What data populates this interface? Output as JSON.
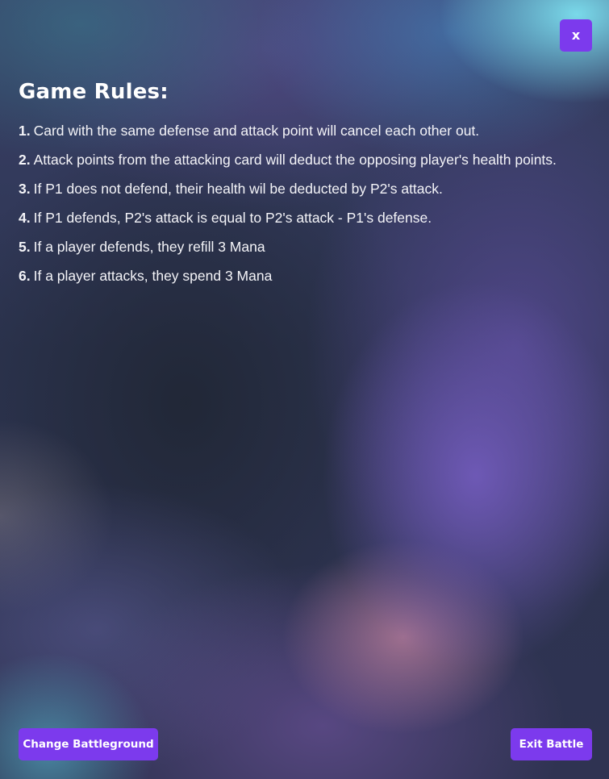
{
  "colors": {
    "accent": "#7c3aed",
    "text": "#ffffff"
  },
  "close_button": {
    "label": "x"
  },
  "rules": {
    "title": "Game Rules:",
    "items": [
      {
        "number": "1.",
        "text": "Card with the same defense and attack point will cancel each other out."
      },
      {
        "number": "2.",
        "text": "Attack points from the attacking card will deduct the opposing player's health points."
      },
      {
        "number": "3.",
        "text": "If P1 does not defend, their health wil be deducted by P2's attack."
      },
      {
        "number": "4.",
        "text": "If P1 defends, P2's attack is equal to P2's attack - P1's defense."
      },
      {
        "number": "5.",
        "text": "If a player defends, they refill 3 Mana"
      },
      {
        "number": "6.",
        "text": "If a player attacks, they spend 3 Mana"
      }
    ]
  },
  "footer": {
    "change_battleground_label": "Change Battleground",
    "exit_battle_label": "Exit Battle"
  }
}
